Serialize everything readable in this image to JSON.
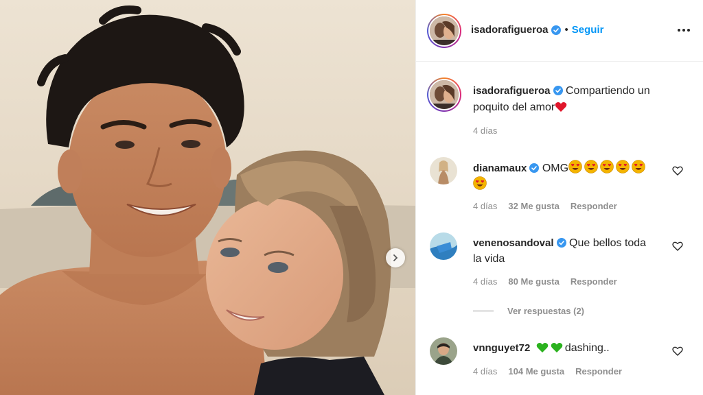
{
  "post": {
    "username": "isadorafigueroa",
    "follow_label": "Seguir",
    "dot": "•",
    "caption_text": "Compartiendo un poquito del amor",
    "caption_time": "4 días"
  },
  "comments": [
    {
      "username": "dianamaux",
      "verified": true,
      "text": "OMG",
      "emoji_count": 6,
      "time": "4 días",
      "likes": "32 Me gusta",
      "reply": "Responder"
    },
    {
      "username": "venenosandoval",
      "verified": true,
      "text": "Que bellos toda la vida",
      "time": "4 días",
      "likes": "80 Me gusta",
      "reply": "Responder"
    },
    {
      "username": "vnnguyet72",
      "verified": false,
      "text": "dashing..",
      "time": "4 días",
      "likes": "104 Me gusta",
      "reply": "Responder"
    }
  ],
  "view_replies": "Ver respuestas (2)",
  "colors": {
    "accent": "#0095f6",
    "text": "#262626",
    "muted": "#8e8e8e",
    "verified": "#3897f0",
    "heart_red": "#e0162b",
    "heart_green": "#2bb21e"
  },
  "icons": [
    "verified-badge-icon",
    "more-options-icon",
    "like-heart-icon",
    "chevron-right-icon",
    "red-heart-emoji-icon",
    "heart-eyes-emoji-icon",
    "green-heart-emoji-icon"
  ]
}
